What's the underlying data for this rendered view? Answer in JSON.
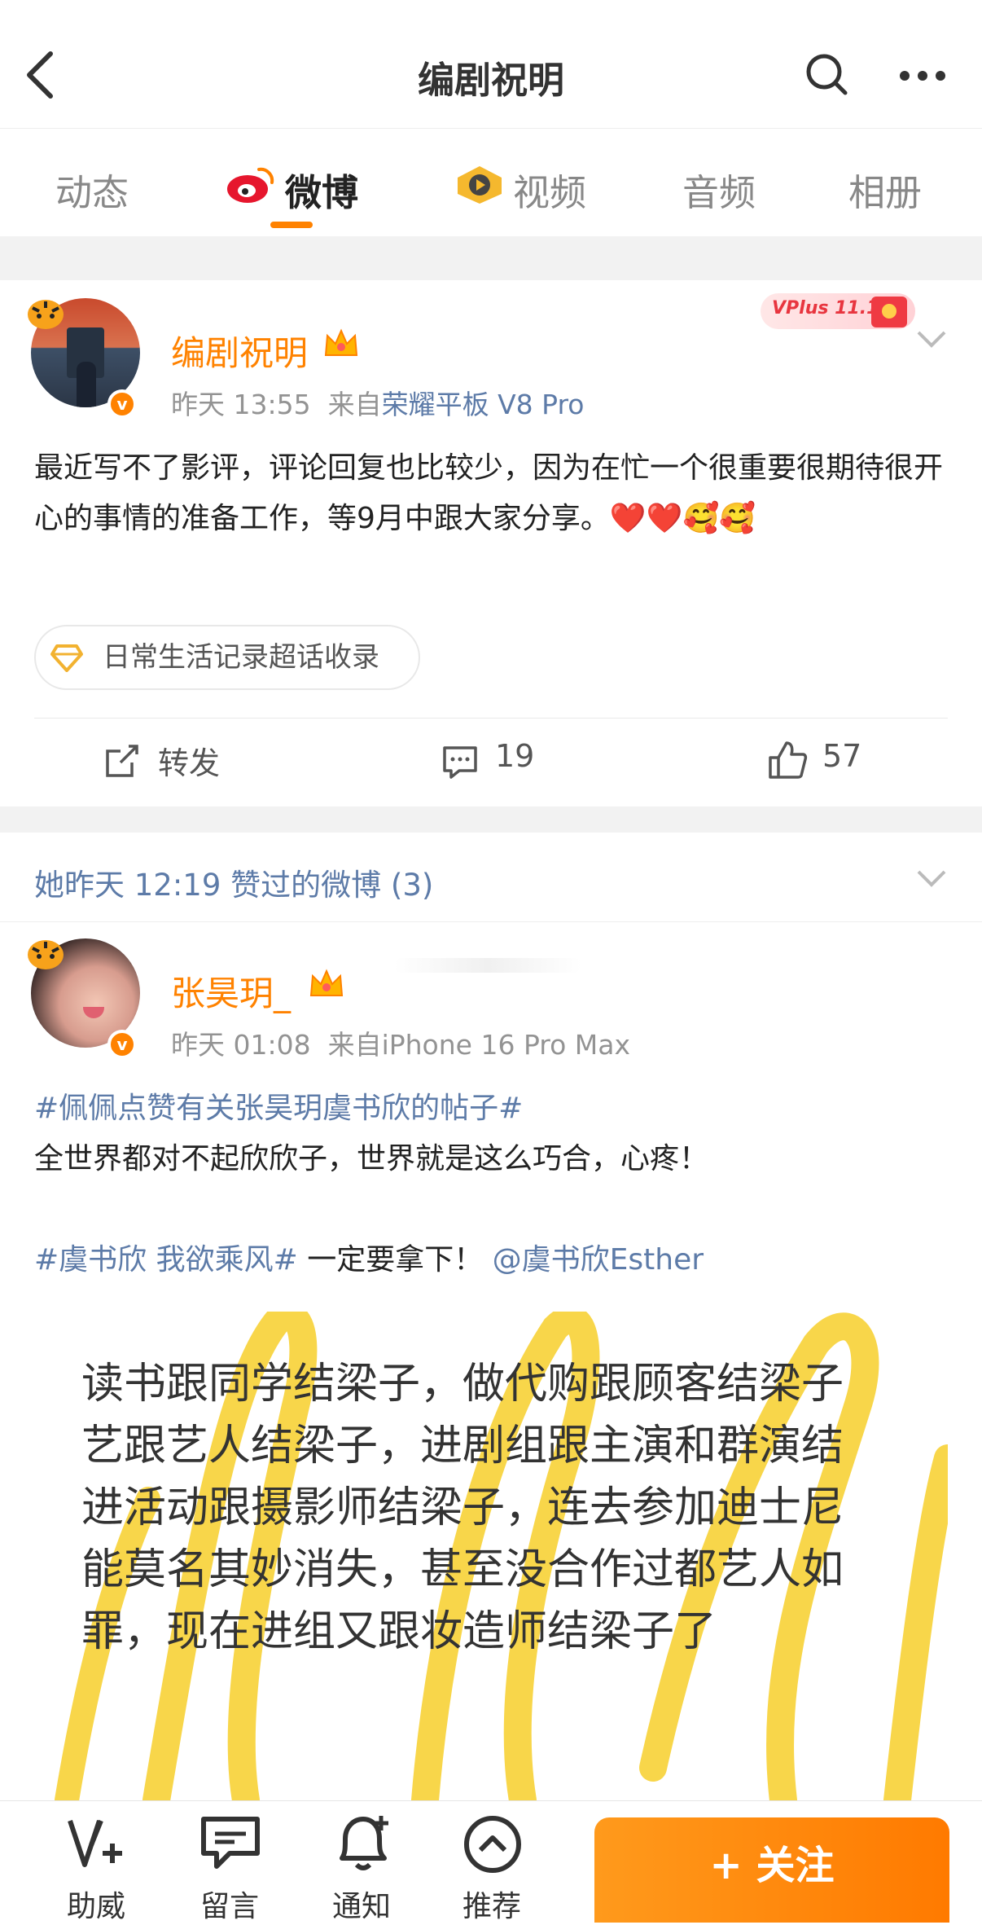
{
  "header": {
    "title": "编剧祝明"
  },
  "tabs": [
    {
      "label": "动态"
    },
    {
      "label": "微博"
    },
    {
      "label": "视频"
    },
    {
      "label": "音频"
    },
    {
      "label": "相册"
    }
  ],
  "post1": {
    "username": "编剧祝明",
    "time": "昨天 13:55",
    "source_prefix": "来自",
    "source": "荣耀平板 V8 Pro",
    "badge_text": "VPlus 11.11",
    "text": "最近写不了影评，评论回复也比较少，因为在忙一个很重要很期待很开心的事情的准备工作，等9月中跟大家分享。❤️❤️🥰🥰",
    "supertopic": "日常生活记录超话收录",
    "actions": {
      "repost": "转发",
      "comments": "19",
      "likes": "57"
    }
  },
  "liked_header": {
    "text": "她昨天 12:19 赞过的微博 (3)"
  },
  "post2": {
    "username": "张昊玥_",
    "time": "昨天 01:08",
    "source_prefix": "来自",
    "source": "iPhone 16 Pro Max",
    "topic1": "#佩佩点赞有关张昊玥虞书欣的帖子#",
    "line1": "全世界都对不起欣欣子，世界就是这么巧合，心疼！",
    "topic2": "#虞书欣 我欲乘风#",
    "line2": " 一定要拿下！ ",
    "mention": "@虞书欣Esther",
    "image_lines": [
      "读书跟同学结梁子，做代购跟顾客结梁子",
      "艺跟艺人结梁子，进剧组跟主演和群演结",
      "进活动跟摄影师结梁子，连去参加迪士尼",
      "能莫名其妙消失，甚至没合作过都艺人如",
      "罪，现在进组又跟妆造师结梁子了"
    ]
  },
  "bottom_bar": {
    "items": [
      {
        "label": "助威"
      },
      {
        "label": "留言"
      },
      {
        "label": "通知"
      },
      {
        "label": "推荐"
      }
    ],
    "follow": "+ 关注"
  },
  "colors": {
    "accent": "#ff8200",
    "link": "#5d7ba8"
  }
}
